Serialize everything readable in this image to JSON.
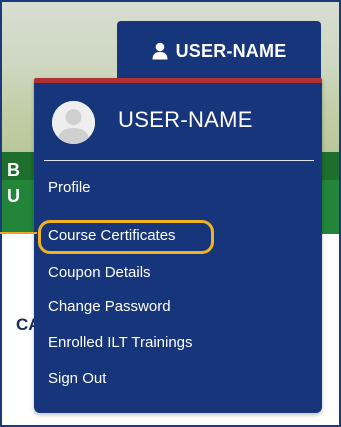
{
  "user_button": {
    "label": "USER-NAME",
    "icon": "user-icon"
  },
  "menu": {
    "username": "USER-NAME",
    "items": [
      {
        "label": "Profile"
      },
      {
        "label": "Course Certificates",
        "highlighted": true
      },
      {
        "label": "Coupon Details"
      },
      {
        "label": "Change Password"
      },
      {
        "label": "Enrolled ILT Trainings"
      },
      {
        "label": "Sign Out"
      }
    ]
  },
  "background": {
    "letter_1": "B",
    "letter_2": "U",
    "letter_3": "CA"
  },
  "colors": {
    "navy": "#17357b",
    "accent_red": "#b0302f",
    "highlight": "#f0b323",
    "green": "#22853a"
  }
}
